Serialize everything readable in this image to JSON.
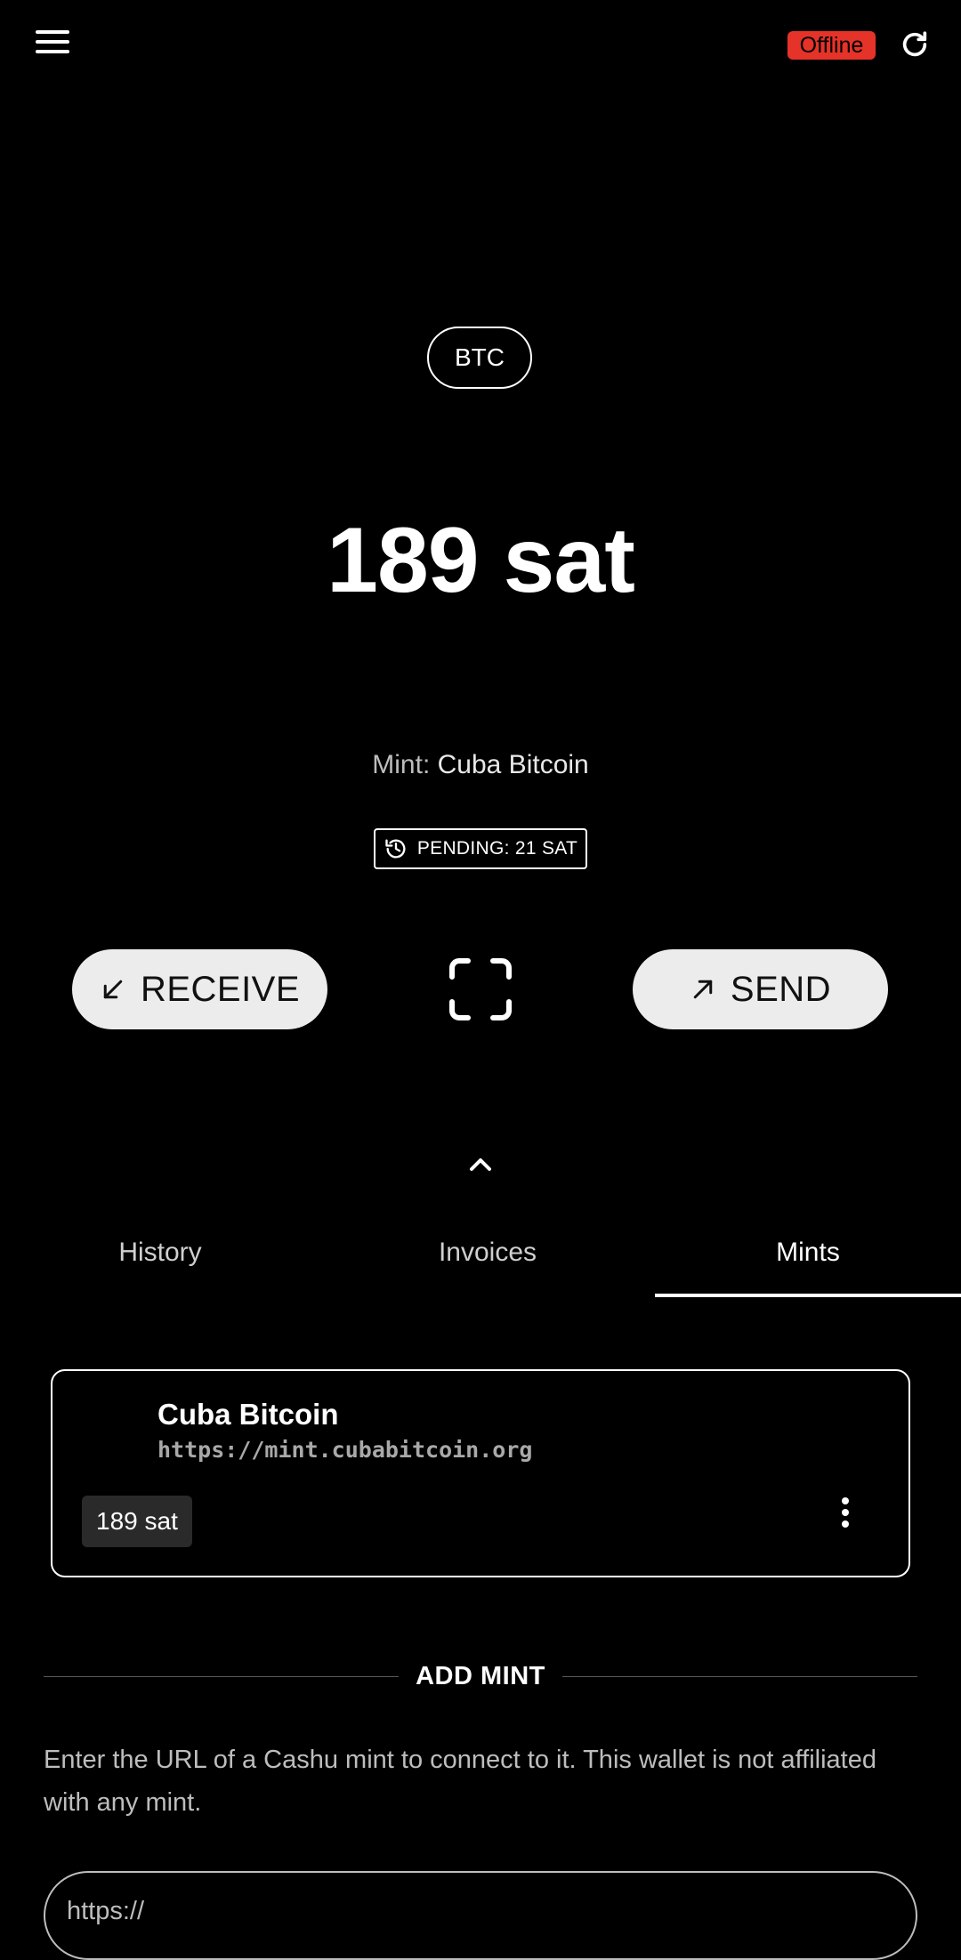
{
  "header": {
    "status_badge": "Offline",
    "status_color": "#e5332a",
    "menu_icon": "hamburger-menu-icon",
    "refresh_icon": "refresh-icon"
  },
  "wallet": {
    "currency": "BTC",
    "balance": "189 sat",
    "mint_label": "Mint:",
    "mint_name": "Cuba Bitcoin",
    "pending_label": "PENDING: 21 SAT",
    "pending_icon": "history-icon"
  },
  "actions": {
    "receive_label": "RECEIVE",
    "receive_icon": "arrow-down-left-icon",
    "send_label": "SEND",
    "send_icon": "arrow-up-right-icon",
    "scan_icon": "scan-frame-icon",
    "expand_icon": "chevron-up-icon"
  },
  "tabs": [
    {
      "label": "History",
      "active": false
    },
    {
      "label": "Invoices",
      "active": false
    },
    {
      "label": "Mints",
      "active": true
    }
  ],
  "mints": [
    {
      "name": "Cuba Bitcoin",
      "url": "https://mint.cubabitcoin.org",
      "balance": "189 sat",
      "menu_icon": "more-vertical-icon"
    }
  ],
  "add_mint": {
    "title": "ADD MINT",
    "description": "Enter the URL of a Cashu mint to connect to it. This wallet is not affiliated with any mint.",
    "url_placeholder": "https://",
    "url_value": ""
  }
}
